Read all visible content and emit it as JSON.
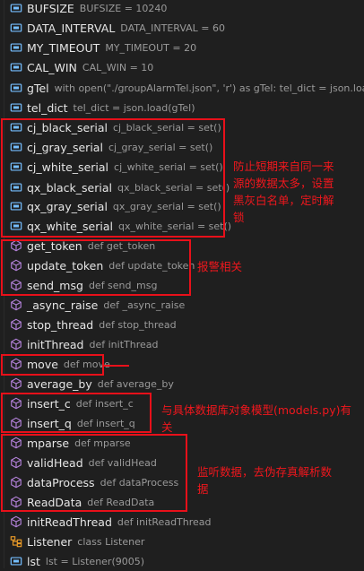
{
  "symbols": [
    {
      "icon": "variable-icon",
      "name": "BUFSIZE",
      "desc": "BUFSIZE = 10240"
    },
    {
      "icon": "variable-icon",
      "name": "DATA_INTERVAL",
      "desc": "DATA_INTERVAL = 60"
    },
    {
      "icon": "variable-icon",
      "name": "MY_TIMEOUT",
      "desc": "MY_TIMEOUT = 20"
    },
    {
      "icon": "variable-icon",
      "name": "CAL_WIN",
      "desc": "CAL_WIN = 10"
    },
    {
      "icon": "variable-icon",
      "name": "gTel",
      "desc": "with open(\"./groupAlarmTel.json\", 'r') as gTel: tel_dict = json.load(g..."
    },
    {
      "icon": "variable-icon",
      "name": "tel_dict",
      "desc": "tel_dict = json.load(gTel)"
    },
    {
      "icon": "variable-icon",
      "name": "cj_black_serial",
      "desc": "cj_black_serial = set()"
    },
    {
      "icon": "variable-icon",
      "name": "cj_gray_serial",
      "desc": "cj_gray_serial = set()"
    },
    {
      "icon": "variable-icon",
      "name": "cj_white_serial",
      "desc": "cj_white_serial = set()"
    },
    {
      "icon": "variable-icon",
      "name": "qx_black_serial",
      "desc": "qx_black_serial = set()"
    },
    {
      "icon": "variable-icon",
      "name": "qx_gray_serial",
      "desc": "qx_gray_serial = set()"
    },
    {
      "icon": "variable-icon",
      "name": "qx_white_serial",
      "desc": "qx_white_serial = set()"
    },
    {
      "icon": "function-icon",
      "name": "get_token",
      "desc": "def get_token"
    },
    {
      "icon": "function-icon",
      "name": "update_token",
      "desc": "def update_token"
    },
    {
      "icon": "function-icon",
      "name": "send_msg",
      "desc": "def send_msg"
    },
    {
      "icon": "function-icon",
      "name": "_async_raise",
      "desc": "def _async_raise"
    },
    {
      "icon": "function-icon",
      "name": "stop_thread",
      "desc": "def stop_thread"
    },
    {
      "icon": "function-icon",
      "name": "initThread",
      "desc": "def initThread"
    },
    {
      "icon": "function-icon",
      "name": "move",
      "desc": "def move"
    },
    {
      "icon": "function-icon",
      "name": "average_by",
      "desc": "def average_by"
    },
    {
      "icon": "function-icon",
      "name": "insert_c",
      "desc": "def insert_c"
    },
    {
      "icon": "function-icon",
      "name": "insert_q",
      "desc": "def insert_q"
    },
    {
      "icon": "function-icon",
      "name": "mparse",
      "desc": "def mparse"
    },
    {
      "icon": "function-icon",
      "name": "validHead",
      "desc": "def validHead"
    },
    {
      "icon": "function-icon",
      "name": "dataProcess",
      "desc": "def dataProcess"
    },
    {
      "icon": "function-icon",
      "name": "ReadData",
      "desc": "def ReadData"
    },
    {
      "icon": "function-icon",
      "name": "initReadThread",
      "desc": "def initReadThread"
    },
    {
      "icon": "class-icon",
      "name": "Listener",
      "desc": "class Listener"
    },
    {
      "icon": "variable-icon",
      "name": "lst",
      "desc": "lst = Listener(9005)"
    }
  ],
  "annotations": {
    "serial_lists": "防止短期来自同一来源的数据太多，设置黑灰白名单，定时解锁",
    "alarm": "报警相关",
    "database": "与具体数据库对象模型(models.py)有关",
    "parse": "监听数据，去伪存真解析数据"
  },
  "colors": {
    "background": "#1f1f1f",
    "variable_icon": "#75beff",
    "function_icon": "#b180d7",
    "class_icon": "#ee9d28",
    "annotation_red": "#e8101a"
  }
}
